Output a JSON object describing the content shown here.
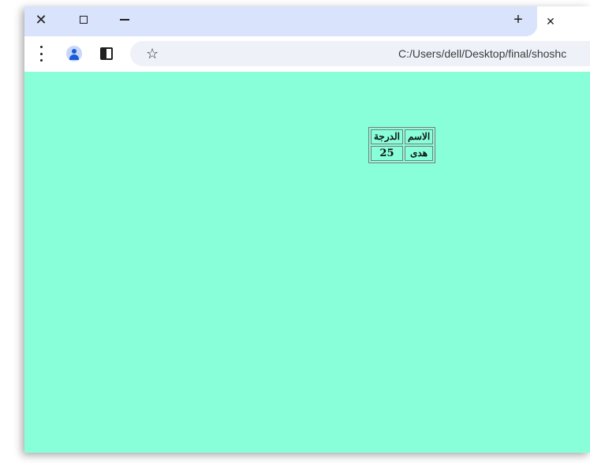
{
  "window_controls": {
    "close_glyph": "✕",
    "newtab_glyph": "+",
    "tab_close_glyph": "✕"
  },
  "toolbar": {
    "url": "C:/Users/dell/Desktop/final/shoshc"
  },
  "table": {
    "headers": [
      "الاسم",
      "الدرجة"
    ],
    "rows": [
      [
        "هدى",
        "25"
      ]
    ]
  },
  "colors": {
    "page_background": "#88ffd8",
    "tabstrip": "#d9e3fb",
    "profile_accent": "#1a5bd6"
  },
  "icons": [
    "close-icon",
    "maximize-icon",
    "minimize-icon",
    "new-tab-icon",
    "kebab-menu-icon",
    "profile-icon",
    "side-panel-icon",
    "bookmark-star-icon"
  ]
}
